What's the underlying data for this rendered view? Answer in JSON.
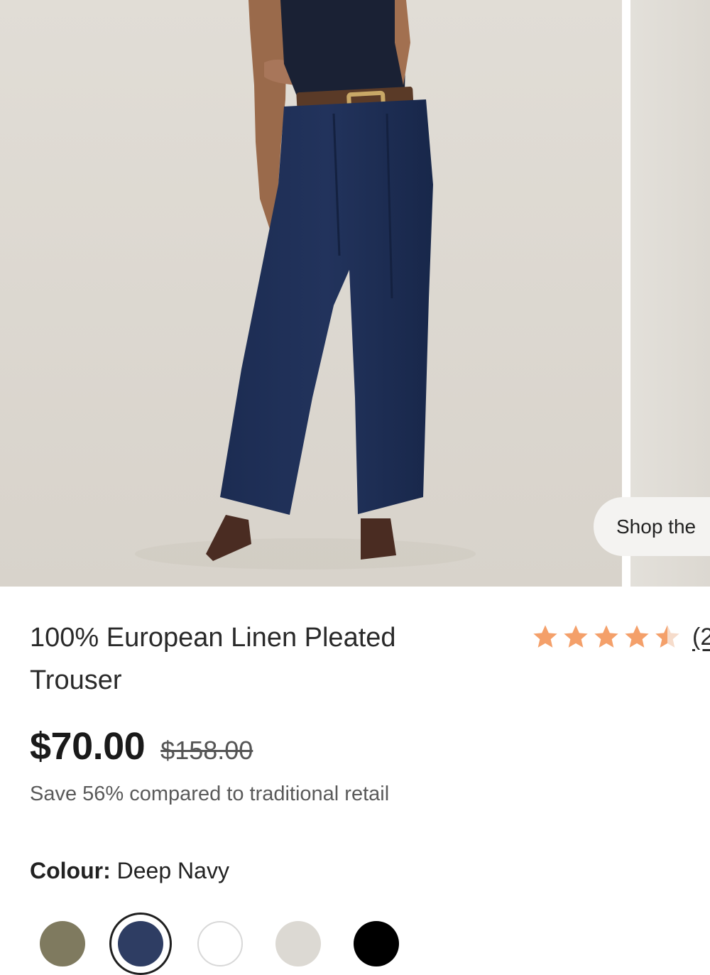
{
  "gallery": {
    "shop_the_look_label": "Shop the"
  },
  "product": {
    "title": "100% European Linen Pleated Trouser",
    "rating": 4.5,
    "review_count": "(2",
    "price": "$70.00",
    "original_price": "$158.00",
    "savings_text": "Save 56% compared to traditional retail",
    "colour_label": "Colour:",
    "colour_value": "Deep Navy"
  },
  "colours": {
    "accent_star": "#f4a06a",
    "swatches": [
      "#7f7a5f",
      "#2e3d63",
      "#ffffff",
      "#dcd9d3",
      "#000000"
    ],
    "selected_index": 1
  }
}
